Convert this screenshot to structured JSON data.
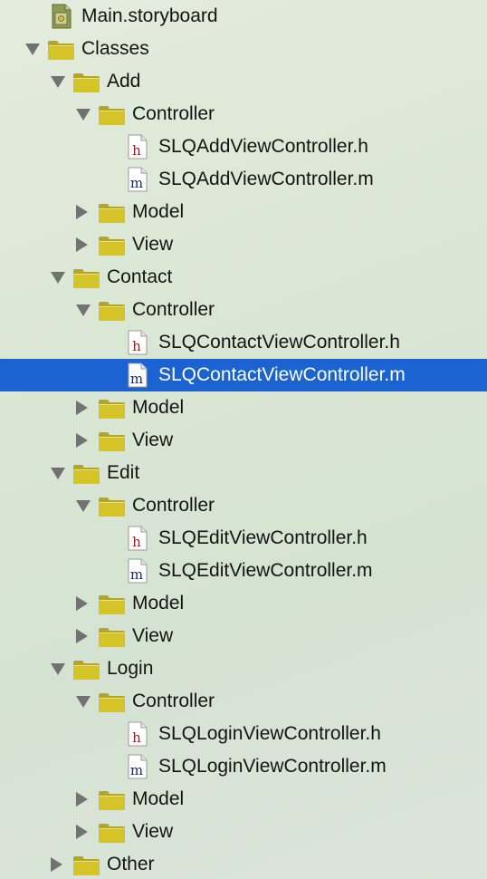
{
  "tree": [
    {
      "label": "Main.storyboard",
      "kind": "storyboard",
      "level": 0,
      "disclosure": "none",
      "name": "tree-item-main-storyboard"
    },
    {
      "label": "Classes",
      "kind": "folder",
      "level": 0,
      "disclosure": "open",
      "name": "tree-item-classes"
    },
    {
      "label": "Add",
      "kind": "folder",
      "level": 1,
      "disclosure": "open",
      "name": "tree-item-add"
    },
    {
      "label": "Controller",
      "kind": "folder",
      "level": 2,
      "disclosure": "open",
      "name": "tree-item-add-controller"
    },
    {
      "label": "SLQAddViewController.h",
      "kind": "h",
      "level": 3,
      "disclosure": "none",
      "name": "tree-item-slqaddviewcontroller-h"
    },
    {
      "label": "SLQAddViewController.m",
      "kind": "m",
      "level": 3,
      "disclosure": "none",
      "name": "tree-item-slqaddviewcontroller-m"
    },
    {
      "label": "Model",
      "kind": "folder",
      "level": 2,
      "disclosure": "closed",
      "name": "tree-item-add-model"
    },
    {
      "label": "View",
      "kind": "folder",
      "level": 2,
      "disclosure": "closed",
      "name": "tree-item-add-view"
    },
    {
      "label": "Contact",
      "kind": "folder",
      "level": 1,
      "disclosure": "open",
      "name": "tree-item-contact"
    },
    {
      "label": "Controller",
      "kind": "folder",
      "level": 2,
      "disclosure": "open",
      "name": "tree-item-contact-controller"
    },
    {
      "label": "SLQContactViewController.h",
      "kind": "h",
      "level": 3,
      "disclosure": "none",
      "name": "tree-item-slqcontactviewcontroller-h"
    },
    {
      "label": "SLQContactViewController.m",
      "kind": "m",
      "level": 3,
      "disclosure": "none",
      "selected": true,
      "name": "tree-item-slqcontactviewcontroller-m"
    },
    {
      "label": "Model",
      "kind": "folder",
      "level": 2,
      "disclosure": "closed",
      "name": "tree-item-contact-model"
    },
    {
      "label": "View",
      "kind": "folder",
      "level": 2,
      "disclosure": "closed",
      "name": "tree-item-contact-view"
    },
    {
      "label": "Edit",
      "kind": "folder",
      "level": 1,
      "disclosure": "open",
      "name": "tree-item-edit"
    },
    {
      "label": "Controller",
      "kind": "folder",
      "level": 2,
      "disclosure": "open",
      "name": "tree-item-edit-controller"
    },
    {
      "label": "SLQEditViewController.h",
      "kind": "h",
      "level": 3,
      "disclosure": "none",
      "name": "tree-item-slqeditviewcontroller-h"
    },
    {
      "label": "SLQEditViewController.m",
      "kind": "m",
      "level": 3,
      "disclosure": "none",
      "name": "tree-item-slqeditviewcontroller-m"
    },
    {
      "label": "Model",
      "kind": "folder",
      "level": 2,
      "disclosure": "closed",
      "name": "tree-item-edit-model"
    },
    {
      "label": "View",
      "kind": "folder",
      "level": 2,
      "disclosure": "closed",
      "name": "tree-item-edit-view"
    },
    {
      "label": "Login",
      "kind": "folder",
      "level": 1,
      "disclosure": "open",
      "name": "tree-item-login"
    },
    {
      "label": "Controller",
      "kind": "folder",
      "level": 2,
      "disclosure": "open",
      "name": "tree-item-login-controller"
    },
    {
      "label": "SLQLoginViewController.h",
      "kind": "h",
      "level": 3,
      "disclosure": "none",
      "name": "tree-item-slqloginviewcontroller-h"
    },
    {
      "label": "SLQLoginViewController.m",
      "kind": "m",
      "level": 3,
      "disclosure": "none",
      "name": "tree-item-slqloginviewcontroller-m"
    },
    {
      "label": "Model",
      "kind": "folder",
      "level": 2,
      "disclosure": "closed",
      "name": "tree-item-login-model"
    },
    {
      "label": "View",
      "kind": "folder",
      "level": 2,
      "disclosure": "closed",
      "name": "tree-item-login-view"
    },
    {
      "label": "Other",
      "kind": "folder",
      "level": 1,
      "disclosure": "closed",
      "name": "tree-item-other"
    }
  ],
  "colors": {
    "selection": "#1a63d0",
    "folder": "#d4c427",
    "disclosure": "#727272",
    "h_letter": "#9b1c1c",
    "m_letter": "#1c2a6b"
  },
  "icons": {
    "folder": "folder-icon",
    "h": "header-file-icon",
    "m": "objc-source-file-icon",
    "storyboard": "storyboard-icon"
  }
}
